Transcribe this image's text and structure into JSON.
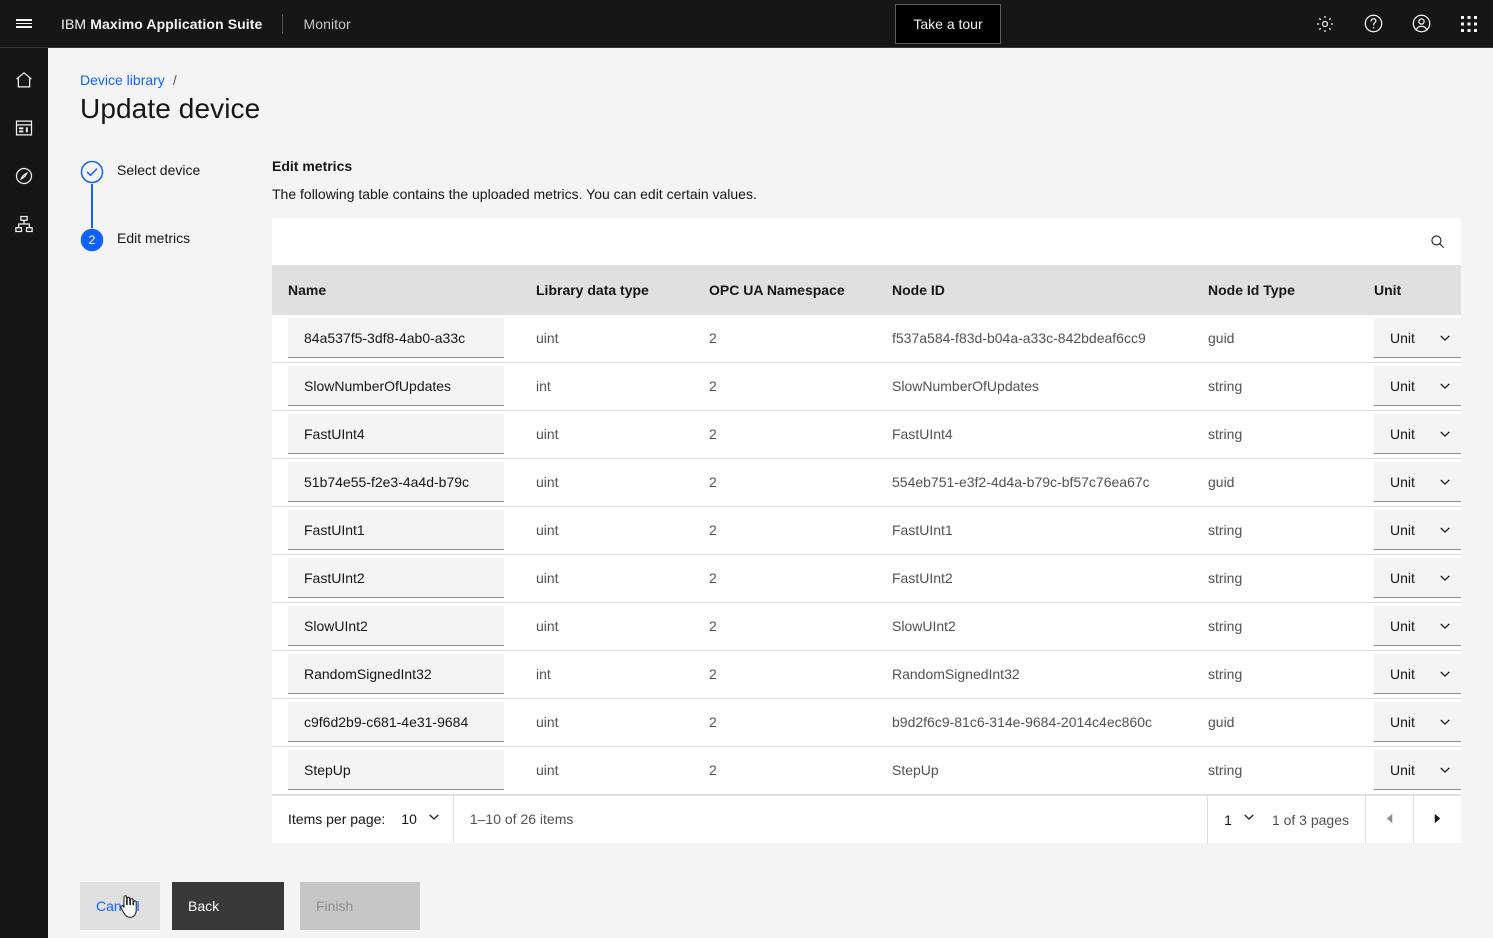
{
  "header": {
    "menu_icon": "hamburger-menu-icon",
    "brand_prefix": "IBM",
    "brand_name": "Maximo Application Suite",
    "app_name": "Monitor",
    "tour_label": "Take a tour",
    "icons": [
      "gear-icon",
      "help-icon",
      "user-avatar-icon",
      "app-switcher-icon"
    ]
  },
  "sidebar": {
    "items": [
      {
        "name": "home-icon",
        "label": "Home"
      },
      {
        "name": "dashboard-icon",
        "label": "Dashboard"
      },
      {
        "name": "explore-compass-icon",
        "label": "Explore"
      },
      {
        "name": "asset-hierarchy-icon",
        "label": "Asset hierarchy"
      }
    ]
  },
  "breadcrumb": {
    "link": "Device library",
    "separator": "/"
  },
  "page": {
    "title": "Update device"
  },
  "stepper": {
    "steps": [
      {
        "label": "Select device",
        "state": "complete",
        "number": "1"
      },
      {
        "label": "Edit metrics",
        "state": "current",
        "number": "2"
      }
    ]
  },
  "section": {
    "heading": "Edit metrics",
    "description": "The following table contains the uploaded metrics. You can edit certain values."
  },
  "toolbar": {
    "search_icon": "search-icon",
    "search_placeholder": ""
  },
  "table": {
    "columns": [
      "Name",
      "Library data type",
      "OPC UA Namespace",
      "Node ID",
      "Node Id Type",
      "Unit"
    ],
    "unit_placeholder": "Unit",
    "rows": [
      {
        "name": "84a537f5-3df8-4ab0-a33c",
        "library_data_type": "uint",
        "opc_ua_namespace": "2",
        "node_id": "f537a584-f83d-b04a-a33c-842bdeaf6cc9",
        "node_id_type": "guid",
        "unit": "Unit"
      },
      {
        "name": "SlowNumberOfUpdates",
        "library_data_type": "int",
        "opc_ua_namespace": "2",
        "node_id": "SlowNumberOfUpdates",
        "node_id_type": "string",
        "unit": "Unit"
      },
      {
        "name": "FastUInt4",
        "library_data_type": "uint",
        "opc_ua_namespace": "2",
        "node_id": "FastUInt4",
        "node_id_type": "string",
        "unit": "Unit"
      },
      {
        "name": "51b74e55-f2e3-4a4d-b79c",
        "library_data_type": "uint",
        "opc_ua_namespace": "2",
        "node_id": "554eb751-e3f2-4d4a-b79c-bf57c76ea67c",
        "node_id_type": "guid",
        "unit": "Unit"
      },
      {
        "name": "FastUInt1",
        "library_data_type": "uint",
        "opc_ua_namespace": "2",
        "node_id": "FastUInt1",
        "node_id_type": "string",
        "unit": "Unit"
      },
      {
        "name": "FastUInt2",
        "library_data_type": "uint",
        "opc_ua_namespace": "2",
        "node_id": "FastUInt2",
        "node_id_type": "string",
        "unit": "Unit"
      },
      {
        "name": "SlowUInt2",
        "library_data_type": "uint",
        "opc_ua_namespace": "2",
        "node_id": "SlowUInt2",
        "node_id_type": "string",
        "unit": "Unit"
      },
      {
        "name": "RandomSignedInt32",
        "library_data_type": "int",
        "opc_ua_namespace": "2",
        "node_id": "RandomSignedInt32",
        "node_id_type": "string",
        "unit": "Unit"
      },
      {
        "name": "c9f6d2b9-c681-4e31-9684",
        "library_data_type": "uint",
        "opc_ua_namespace": "2",
        "node_id": "b9d2f6c9-81c6-314e-9684-2014c4ec860c",
        "node_id_type": "guid",
        "unit": "Unit"
      },
      {
        "name": "StepUp",
        "library_data_type": "uint",
        "opc_ua_namespace": "2",
        "node_id": "StepUp",
        "node_id_type": "string",
        "unit": "Unit"
      }
    ]
  },
  "pagination": {
    "items_per_page_label": "Items per page:",
    "items_per_page_value": "10",
    "range_text": "1–10 of 26 items",
    "page_value": "1",
    "pages_text": "1 of 3 pages",
    "prev_label": "Previous page",
    "next_label": "Next page"
  },
  "footer": {
    "cancel_label": "Cancel",
    "back_label": "Back",
    "finish_label": "Finish"
  },
  "colors": {
    "accent_blue": "#0f62fe",
    "header_black": "#161616",
    "page_bg": "#f4f4f4",
    "table_header_bg": "#e0e0e0",
    "field_bg": "#f4f4f4",
    "button_back_bg": "#393939",
    "button_disabled_bg": "#c6c6c6"
  }
}
